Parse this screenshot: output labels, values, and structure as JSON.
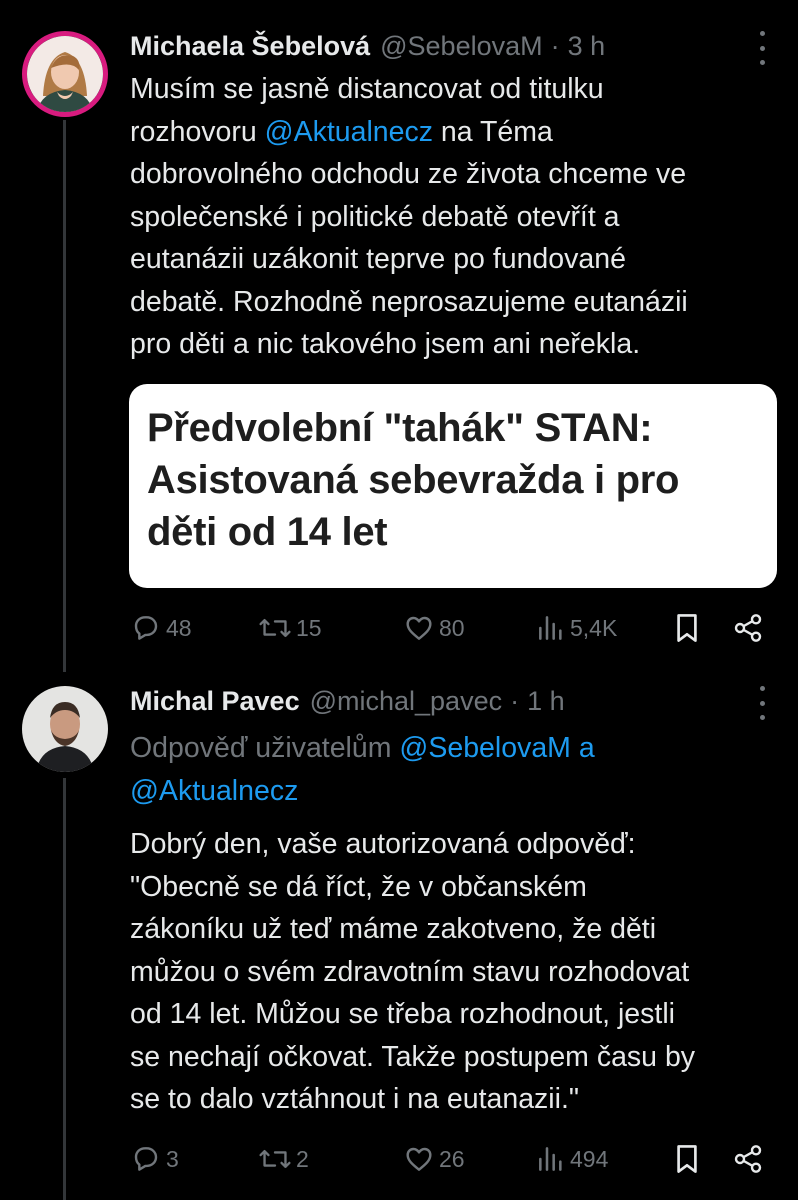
{
  "colors": {
    "background": "#000000",
    "text": "#e7e9ea",
    "muted": "#71767b",
    "link": "#1d9bf0",
    "thread_line": "#333639"
  },
  "tweets": [
    {
      "author_name": "Michaela Šebelová",
      "handle": "@SebelovaM",
      "separator": "·",
      "time": "3 h",
      "avatar_icon": "woman-portrait-avatar",
      "lines": [
        [
          "Musím se jasně distancovat od titulku"
        ],
        [
          "rozhovoru ",
          "@Aktualnecz",
          " na Téma"
        ],
        [
          "dobrovolného odchodu ze života chceme ve"
        ],
        [
          "společenské i politické debatě otevřít a"
        ],
        [
          "eutanázii uzákonit teprve po fundované"
        ],
        [
          "debatě. Rozhodně neprosazujeme eutanázii"
        ],
        [
          "pro děti a nic takového jsem ani neřekla."
        ]
      ],
      "card": {
        "lines": [
          "Předvolební \"tahák\" STAN:",
          "Asistovaná sebevražda i pro",
          "děti od 14 let"
        ]
      },
      "stats": {
        "replies": "48",
        "reposts": "15",
        "likes": "80",
        "views": "5,4K"
      }
    },
    {
      "author_name": "Michal Pavec",
      "handle": "@michal_pavec",
      "separator": "·",
      "time": "1 h",
      "avatar_icon": "man-portrait-avatar",
      "reply_to": {
        "prefix": "Odpověď uživatelům ",
        "user1": "@SebelovaM",
        "conj": " a",
        "user2": "@Aktualnecz"
      },
      "lines": [
        [
          "Dobrý den, vaše autorizovaná odpověď:"
        ],
        [
          "\"Obecně se dá říct, že v občanském"
        ],
        [
          "zákoníku už teď máme zakotveno, že děti"
        ],
        [
          "můžou o svém zdravotním stavu rozhodovat"
        ],
        [
          "od 14 let. Můžou se třeba rozhodnout, jestli"
        ],
        [
          "se nechají očkovat. Takže postupem času by"
        ],
        [
          "se to dalo vztáhnout i na eutanazii.\""
        ]
      ],
      "stats": {
        "replies": "3",
        "reposts": "2",
        "likes": "26",
        "views": "494"
      }
    }
  ]
}
